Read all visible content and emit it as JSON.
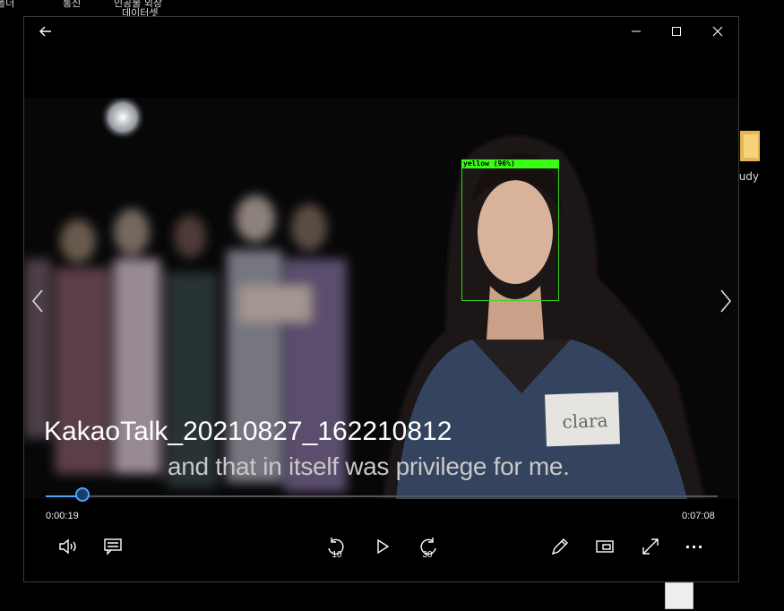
{
  "desktop": {
    "top_labels": [
      "폴더",
      "통신",
      "인공물 외장",
      "데이터셋"
    ],
    "right_label": "tudy"
  },
  "window": {
    "back_icon": "arrow-left-icon",
    "minimize_icon": "minimize-icon",
    "maximize_icon": "maximize-icon",
    "close_icon": "close-icon"
  },
  "video": {
    "detection_label": "yellow (96%)",
    "subtitle": "and that in itself was privilege for me.",
    "name_tag": "clara",
    "file_title": "KakaoTalk_20210827_162210812"
  },
  "player": {
    "current_time": "0:00:19",
    "total_time": "0:07:08",
    "progress": 0.055,
    "skip_back_seconds": "10",
    "skip_forward_seconds": "30",
    "more_label": "···"
  },
  "colors": {
    "accent": "#4da3ff",
    "detection_box": "#39ff14"
  }
}
